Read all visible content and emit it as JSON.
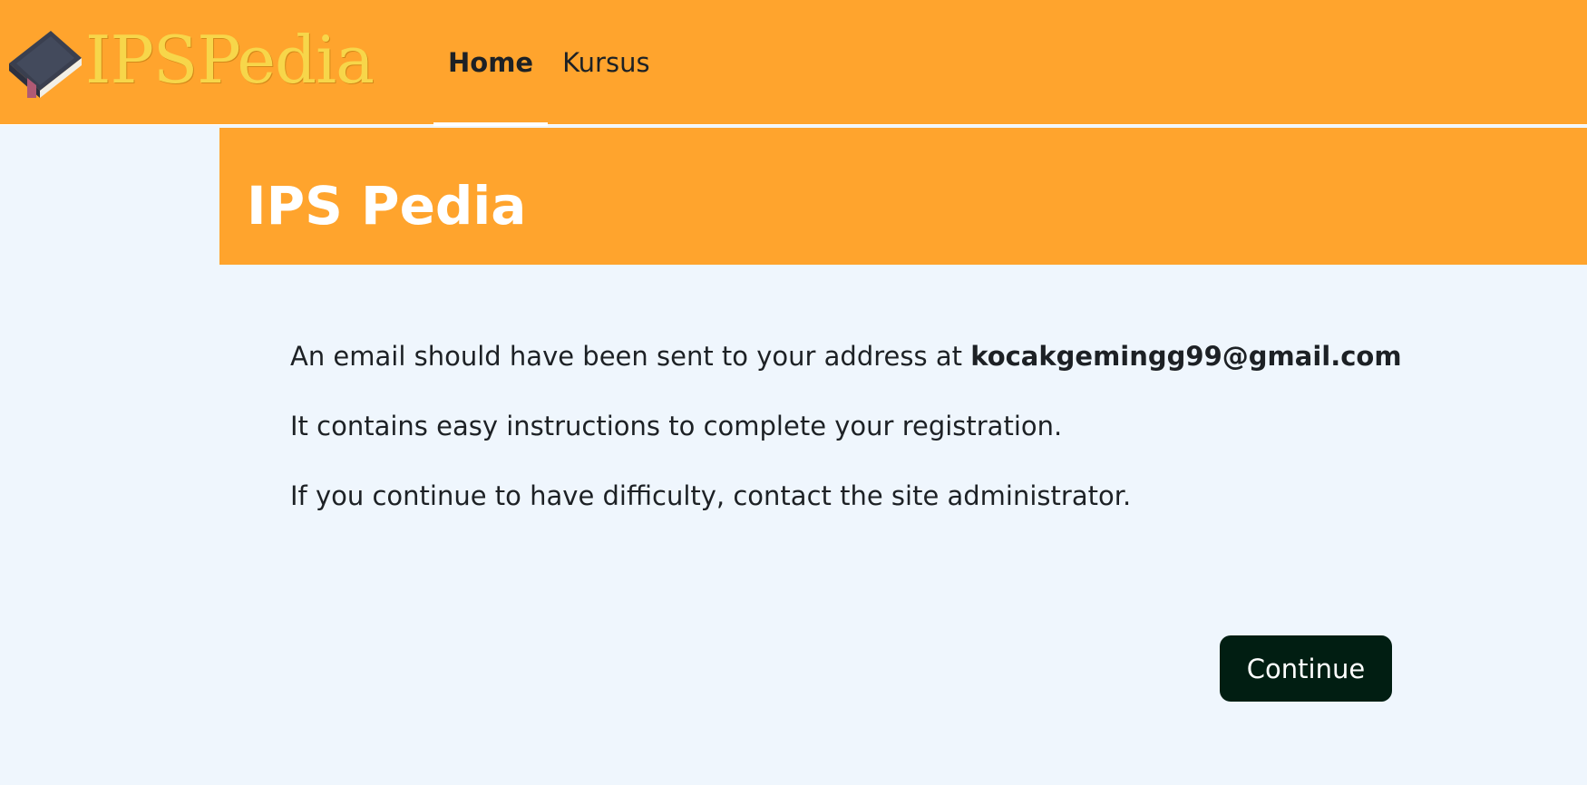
{
  "brand": {
    "name": "IPSPedia",
    "logo_icon": "book-icon"
  },
  "nav": {
    "items": [
      {
        "label": "Home",
        "active": true
      },
      {
        "label": "Kursus",
        "active": false
      }
    ]
  },
  "header": {
    "title": "IPS Pedia"
  },
  "message": {
    "line1_prefix": "An email should have been sent to your address at",
    "email": "kocakgemingg99@gmail.com",
    "line2": "It contains easy instructions to complete your registration.",
    "line3": "If you continue to have difficulty, contact the site administrator."
  },
  "actions": {
    "continue_label": "Continue"
  },
  "colors": {
    "brand_orange": "#ffa42d",
    "background": "#eff6fd",
    "button": "#011e12",
    "logo_text": "#f7d64a"
  }
}
